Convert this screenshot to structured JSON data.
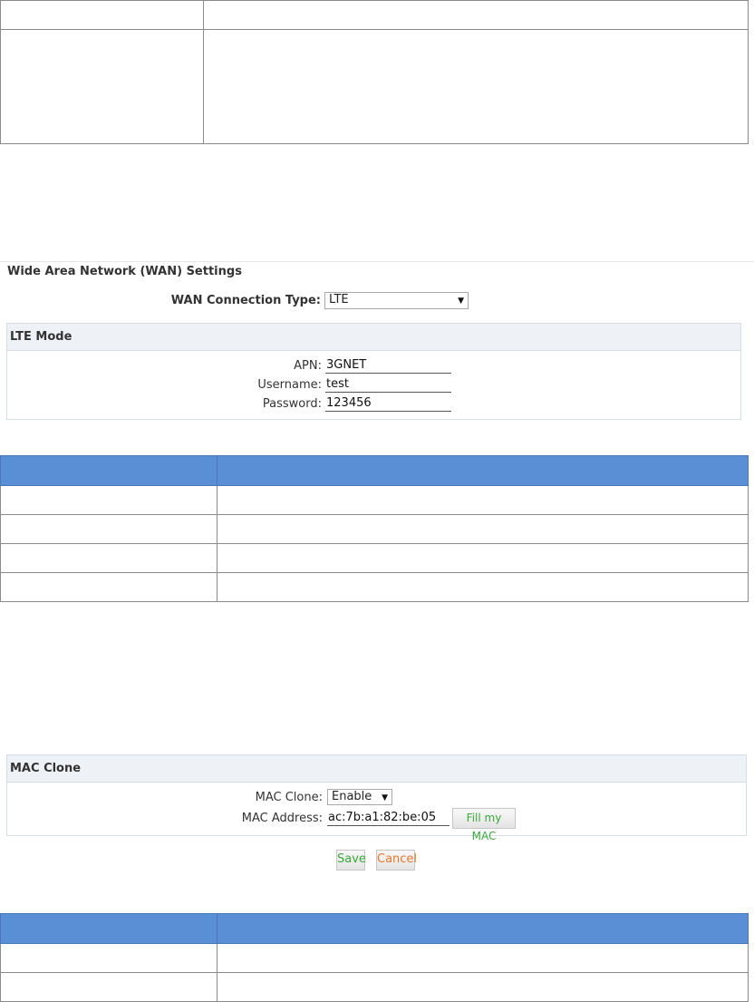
{
  "wan": {
    "section_title": "Wide Area Network (WAN) Settings",
    "connection_type_label": "WAN Connection Type:",
    "connection_type_value": "LTE"
  },
  "lte": {
    "title": "LTE Mode",
    "apn_label": "APN:",
    "apn_value": "3GNET",
    "username_label": "Username:",
    "username_value": "test",
    "password_label": "Password:",
    "password_value": "123456"
  },
  "mac": {
    "title": "MAC Clone",
    "clone_label": "MAC Clone:",
    "clone_value": "Enable",
    "address_label": "MAC Address:",
    "address_value": "ac:7b:a1:82:be:05",
    "fill_button": "Fill my MAC"
  },
  "actions": {
    "save": "Save",
    "cancel": "Cancel"
  },
  "colors": {
    "table_header_blue": "#5a8fd6",
    "save_text": "#3aaa3a",
    "cancel_text": "#e8782a",
    "fill_text": "#3aaa3a"
  }
}
